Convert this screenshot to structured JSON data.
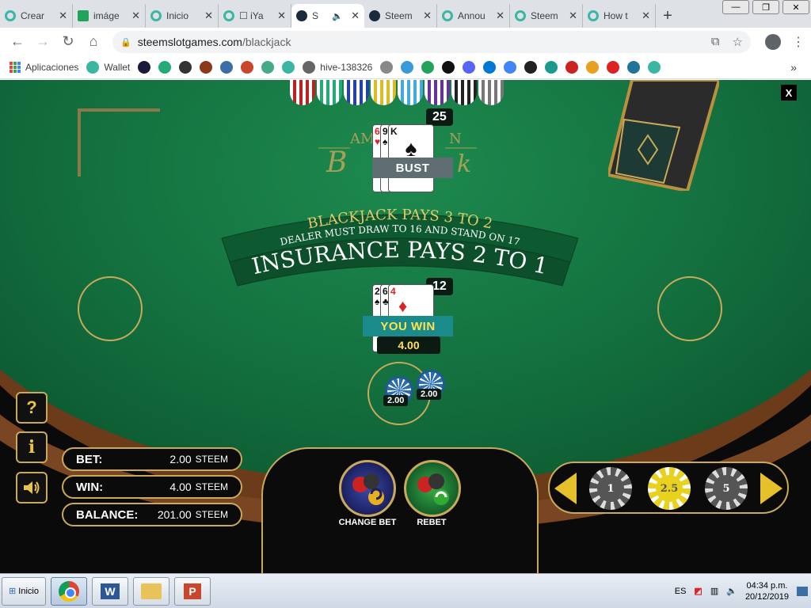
{
  "browser": {
    "tabs": [
      {
        "title": "Crear",
        "icon": "steem-icon"
      },
      {
        "title": "imáge",
        "icon": "image-icon"
      },
      {
        "title": "Inicio",
        "icon": "steem-icon"
      },
      {
        "title": "☐ iYa",
        "icon": "steem-icon"
      },
      {
        "title": "S",
        "icon": "steemslot-icon",
        "active": true,
        "audio": true
      },
      {
        "title": "Steem",
        "icon": "steemslot-icon"
      },
      {
        "title": "Annou",
        "icon": "steem-icon"
      },
      {
        "title": "Steem",
        "icon": "steem-icon"
      },
      {
        "title": "How t",
        "icon": "steem-icon"
      }
    ],
    "url_domain": "steemslotgames.com",
    "url_path": "/blackjack",
    "bookmarks": [
      {
        "label": "Aplicaciones",
        "icon": "apps-icon"
      },
      {
        "label": "Wallet",
        "icon": "steem-icon"
      },
      {
        "label": "",
        "icon": "steem-icon"
      },
      {
        "label": "",
        "icon": "hive-icon"
      },
      {
        "label": "",
        "icon": "globe-icon"
      },
      {
        "label": "",
        "icon": "bolt-icon"
      },
      {
        "label": "",
        "icon": "shield-icon"
      },
      {
        "label": "",
        "icon": "world-icon"
      },
      {
        "label": "",
        "icon": "gear-icon"
      },
      {
        "label": "",
        "icon": "cube-icon"
      },
      {
        "label": "hive-138326",
        "icon": "steem-icon"
      },
      {
        "label": "",
        "icon": "mountain-icon"
      },
      {
        "label": "",
        "icon": "c-icon"
      },
      {
        "label": "",
        "icon": "drop-icon"
      },
      {
        "label": "",
        "icon": "image-icon"
      },
      {
        "label": "",
        "icon": "w-icon"
      },
      {
        "label": "",
        "icon": "discord-icon"
      },
      {
        "label": "",
        "icon": "outlook-icon"
      },
      {
        "label": "",
        "icon": "google-icon"
      },
      {
        "label": "",
        "icon": "edit-icon"
      },
      {
        "label": "",
        "icon": "steemit-icon"
      },
      {
        "label": "",
        "icon": "bird-icon"
      },
      {
        "label": "",
        "icon": "chart-icon"
      },
      {
        "label": "",
        "icon": "flag-icon"
      },
      {
        "label": "",
        "icon": "wordpress-icon"
      }
    ],
    "bookmarks_more": "»"
  },
  "game": {
    "close_label": "X",
    "dealer_score": "25",
    "dealer_status": "BUST",
    "dealer_cards": [
      {
        "rank": "6",
        "suit": "♥",
        "color": "red"
      },
      {
        "rank": "9",
        "suit": "♠",
        "color": "black"
      },
      {
        "rank": "K",
        "suit": "♠",
        "color": "black"
      }
    ],
    "table_title_top": "AM",
    "table_title_top_right": "N",
    "table_title_bottom": "B",
    "table_title_bottom_right": "k",
    "banner_line1": "BLACKJACK PAYS 3 TO 2",
    "banner_line2": "DEALER MUST DRAW TO 16 AND STAND ON 17",
    "banner_line3": "INSURANCE PAYS 2 TO 1",
    "player_score": "12",
    "player_cards": [
      {
        "rank": "2",
        "suit": "♠",
        "color": "black"
      },
      {
        "rank": "6",
        "suit": "♣",
        "color": "black"
      },
      {
        "rank": "4",
        "suit": "♦",
        "color": "red"
      }
    ],
    "player_status": "YOU WIN",
    "win_amount": "4.00",
    "bet_chips": [
      "2.00",
      "2.00"
    ],
    "help_label": "?",
    "info_label": "i",
    "sound_icon": "speaker-icon",
    "stats": {
      "bet_label": "BET:",
      "bet_value": "2.00",
      "win_label": "WIN:",
      "win_value": "4.00",
      "balance_label": "BALANCE:",
      "balance_value": "201.00",
      "currency": "STEEM"
    },
    "actions": {
      "change_bet": "CHANGE BET",
      "rebet": "REBET"
    },
    "chip_selector": [
      "1",
      "2.5",
      "5"
    ]
  },
  "taskbar": {
    "start_label": "Inicio",
    "lang": "ES",
    "time": "04:34 p.m.",
    "date": "20/12/2019"
  },
  "colors": {
    "felt": "#147240",
    "gold": "#c9a95a",
    "rail": "#7a4522"
  }
}
